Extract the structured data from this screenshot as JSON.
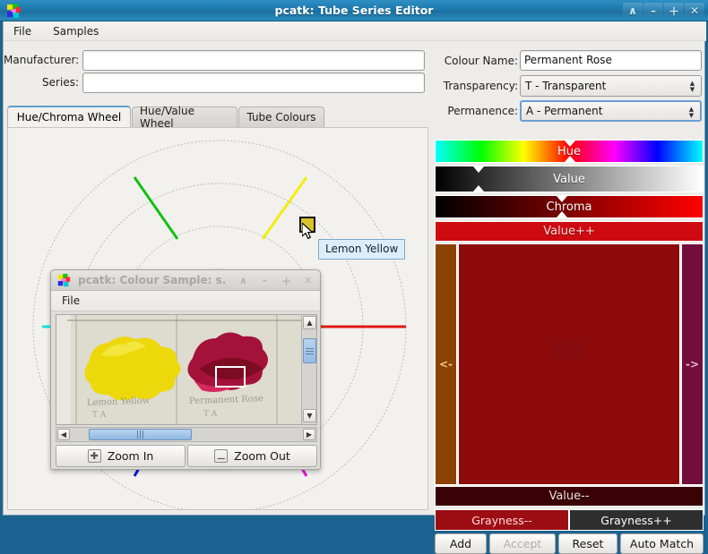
{
  "window": {
    "title": "pcatk: Tube Series Editor",
    "icon": "palette-icon",
    "buttons": [
      {
        "name": "shade-button",
        "glyph": "∧"
      },
      {
        "name": "minimize-button",
        "glyph": "–"
      },
      {
        "name": "maximize-button",
        "glyph": "＋"
      },
      {
        "name": "close-button",
        "glyph": "✕"
      }
    ]
  },
  "menubar": {
    "items": [
      {
        "name": "menu-file",
        "label": "File"
      },
      {
        "name": "menu-samples",
        "label": "Samples"
      }
    ]
  },
  "form": {
    "manufacturer_label": "Manufacturer:",
    "manufacturer_value": "",
    "manufacturer_placeholder": "",
    "series_label": "Series:",
    "series_value": "",
    "series_placeholder": "",
    "colour_name_label": "Colour Name:",
    "colour_name_value": "Permanent Rose",
    "transparency_label": "Transparency:",
    "transparency_value": "T     - Transparent",
    "permanence_label": "Permanence:",
    "permanence_value": "A     - Permanent"
  },
  "tabs": [
    {
      "name": "tab-hue-chroma-wheel",
      "label": "Hue/Chroma Wheel",
      "active": true
    },
    {
      "name": "tab-hue-value-wheel",
      "label": "Hue/Value Wheel",
      "active": false
    },
    {
      "name": "tab-tube-colours",
      "label": "Tube Colours",
      "active": false
    }
  ],
  "wheel": {
    "tooltip": "Lemon Yellow",
    "spokes": [
      {
        "name": "spoke-green",
        "color": "#13c013"
      },
      {
        "name": "spoke-yellow",
        "color": "#f2ee10"
      },
      {
        "name": "spoke-red",
        "color": "#e01a10"
      },
      {
        "name": "spoke-magenta",
        "color": "#e813d8"
      },
      {
        "name": "spoke-blue",
        "color": "#1414d6"
      },
      {
        "name": "spoke-cyan",
        "color": "#18e2e2"
      }
    ],
    "selected_chip_color": "#d8c32a"
  },
  "dialog": {
    "title": "pcatk: Colour Sample: s.",
    "icon": "palette-icon",
    "buttons": [
      {
        "name": "shade-button",
        "glyph": "∧"
      },
      {
        "name": "minimize-button",
        "glyph": "–"
      },
      {
        "name": "maximize-button",
        "glyph": "＋"
      },
      {
        "name": "close-button",
        "glyph": "✕"
      }
    ],
    "menu": [
      {
        "name": "dialog-menu-file",
        "label": "File"
      }
    ],
    "samples": [
      {
        "name": "sample-lemon-yellow",
        "caption": "Lemon Yellow",
        "marks": "T    A",
        "color": "#edd90b"
      },
      {
        "name": "sample-permanent-rose",
        "caption": "Permanent Rose",
        "marks": "T     A",
        "color": "#a4113a"
      }
    ],
    "zoom_in_label": "Zoom In",
    "zoom_out_label": "Zoom Out",
    "zoom_in_icon": "plus-icon",
    "zoom_out_icon": "minus-icon"
  },
  "sliders": {
    "hue": {
      "label": "Hue",
      "marker_pct": 50
    },
    "value": {
      "label": "Value",
      "marker_pct": 16
    },
    "chroma": {
      "label": "Chroma",
      "marker_pct": 47
    }
  },
  "adjust": {
    "value_plus": "Value++",
    "value_minus": "Value--",
    "grayness_minus": "Grayness--",
    "grayness_plus": "Grayness++",
    "left_arrow": "<-",
    "right_arrow": "->"
  },
  "colors": {
    "swatch_main": "#8e0b0b",
    "swatch_left": "#8c4200",
    "swatch_right": "#720d3c",
    "value_plus_bg": "#ce0b11",
    "value_minus_bg": "#3a0205",
    "grayness_minus_bg": "#9c0d14",
    "grayness_plus_bg": "#2e2e2e",
    "titlebar": "#1d79ae",
    "desktop": "#1b6390"
  },
  "actions": [
    {
      "name": "add-button",
      "label": "Add",
      "disabled": false
    },
    {
      "name": "accept-button",
      "label": "Accept",
      "disabled": true
    },
    {
      "name": "reset-button",
      "label": "Reset",
      "disabled": false
    },
    {
      "name": "auto-match-button",
      "label": "Auto Match",
      "disabled": false
    }
  ]
}
